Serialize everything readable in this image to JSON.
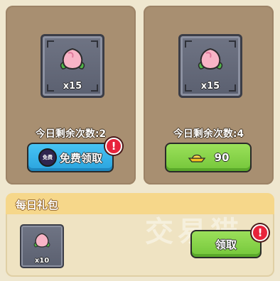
{
  "cards": [
    {
      "quantity": "x15",
      "remaining": "今日剩余次数:2",
      "button": {
        "label": "免费领取",
        "badge": "免费"
      }
    },
    {
      "quantity": "x15",
      "remaining": "今日剩余次数:4",
      "button": {
        "label": "90"
      }
    }
  ],
  "daily": {
    "title": "每日礼包",
    "item": {
      "quantity": "x10"
    },
    "button_label": "领取"
  },
  "alert_glyph": "!",
  "watermark": "交易猫",
  "colors": {
    "blue_button": "#2aa3de",
    "green_button": "#74c63a",
    "alert": "#e8233b",
    "card_bg": "#a88f71"
  },
  "icons": [
    "peach-icon",
    "gold-ingot-icon",
    "free-badge-icon",
    "alert-icon"
  ]
}
